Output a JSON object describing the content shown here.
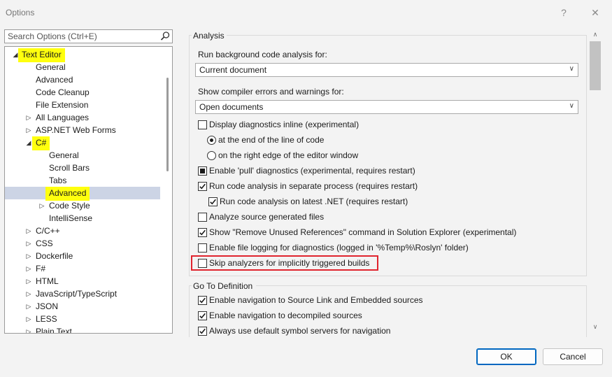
{
  "window": {
    "title": "Options",
    "help_label": "?",
    "close_label": "✕"
  },
  "search": {
    "placeholder": "Search Options (Ctrl+E)"
  },
  "tree": [
    {
      "label": "Text Editor",
      "level": 0,
      "expanded": true,
      "highlighted": true
    },
    {
      "label": "General",
      "level": 1
    },
    {
      "label": "Advanced",
      "level": 1
    },
    {
      "label": "Code Cleanup",
      "level": 1
    },
    {
      "label": "File Extension",
      "level": 1
    },
    {
      "label": "All Languages",
      "level": 1,
      "collapsed": true
    },
    {
      "label": "ASP.NET Web Forms",
      "level": 1,
      "collapsed": true
    },
    {
      "label": "C#",
      "level": 1,
      "expanded": true,
      "highlighted": true
    },
    {
      "label": "General",
      "level": 2
    },
    {
      "label": "Scroll Bars",
      "level": 2
    },
    {
      "label": "Tabs",
      "level": 2
    },
    {
      "label": "Advanced",
      "level": 2,
      "selected": true,
      "highlighted": true
    },
    {
      "label": "Code Style",
      "level": 2,
      "collapsed": true
    },
    {
      "label": "IntelliSense",
      "level": 2
    },
    {
      "label": "C/C++",
      "level": 1,
      "collapsed": true
    },
    {
      "label": "CSS",
      "level": 1,
      "collapsed": true
    },
    {
      "label": "Dockerfile",
      "level": 1,
      "collapsed": true
    },
    {
      "label": "F#",
      "level": 1,
      "collapsed": true
    },
    {
      "label": "HTML",
      "level": 1,
      "collapsed": true
    },
    {
      "label": "JavaScript/TypeScript",
      "level": 1,
      "collapsed": true
    },
    {
      "label": "JSON",
      "level": 1,
      "collapsed": true
    },
    {
      "label": "LESS",
      "level": 1,
      "collapsed": true
    },
    {
      "label": "Plain Text",
      "level": 1,
      "collapsed": true
    }
  ],
  "analysis": {
    "title": "Analysis",
    "bg_label": "Run background code analysis for:",
    "bg_value": "Current document",
    "errors_label": "Show compiler errors and warnings for:",
    "errors_value": "Open documents",
    "options": [
      {
        "label": "Display diagnostics inline (experimental)",
        "type": "checkbox",
        "state": "unchecked"
      },
      {
        "label": "at the end of the line of code",
        "type": "radio",
        "state": "checked"
      },
      {
        "label": "on the right edge of the editor window",
        "type": "radio",
        "state": "unchecked"
      },
      {
        "label": "Enable 'pull' diagnostics (experimental, requires restart)",
        "type": "checkbox",
        "state": "indeterminate"
      },
      {
        "label": "Run code analysis in separate process (requires restart)",
        "type": "checkbox",
        "state": "checked"
      },
      {
        "label": "Run code analysis on latest .NET (requires restart)",
        "type": "checkbox",
        "state": "checked"
      },
      {
        "label": "Analyze source generated files",
        "type": "checkbox",
        "state": "unchecked"
      },
      {
        "label": "Show \"Remove Unused References\" command in Solution Explorer (experimental)",
        "type": "checkbox",
        "state": "checked"
      },
      {
        "label": "Enable file logging for diagnostics (logged in '%Temp%\\Roslyn' folder)",
        "type": "checkbox",
        "state": "unchecked"
      },
      {
        "label": "Skip analyzers for implicitly triggered builds",
        "type": "checkbox",
        "state": "unchecked"
      }
    ]
  },
  "goto": {
    "title": "Go To Definition",
    "options": [
      {
        "label": "Enable navigation to Source Link and Embedded sources",
        "type": "checkbox",
        "state": "checked"
      },
      {
        "label": "Enable navigation to decompiled sources",
        "type": "checkbox",
        "state": "checked"
      },
      {
        "label": "Always use default symbol servers for navigation",
        "type": "checkbox",
        "state": "checked"
      }
    ]
  },
  "buttons": {
    "ok": "OK",
    "cancel": "Cancel"
  },
  "colors": {
    "highlight": "#ffff0e",
    "selection": "#ccd4e5",
    "focus_box": "#e0242e",
    "accent": "#0067c0"
  }
}
